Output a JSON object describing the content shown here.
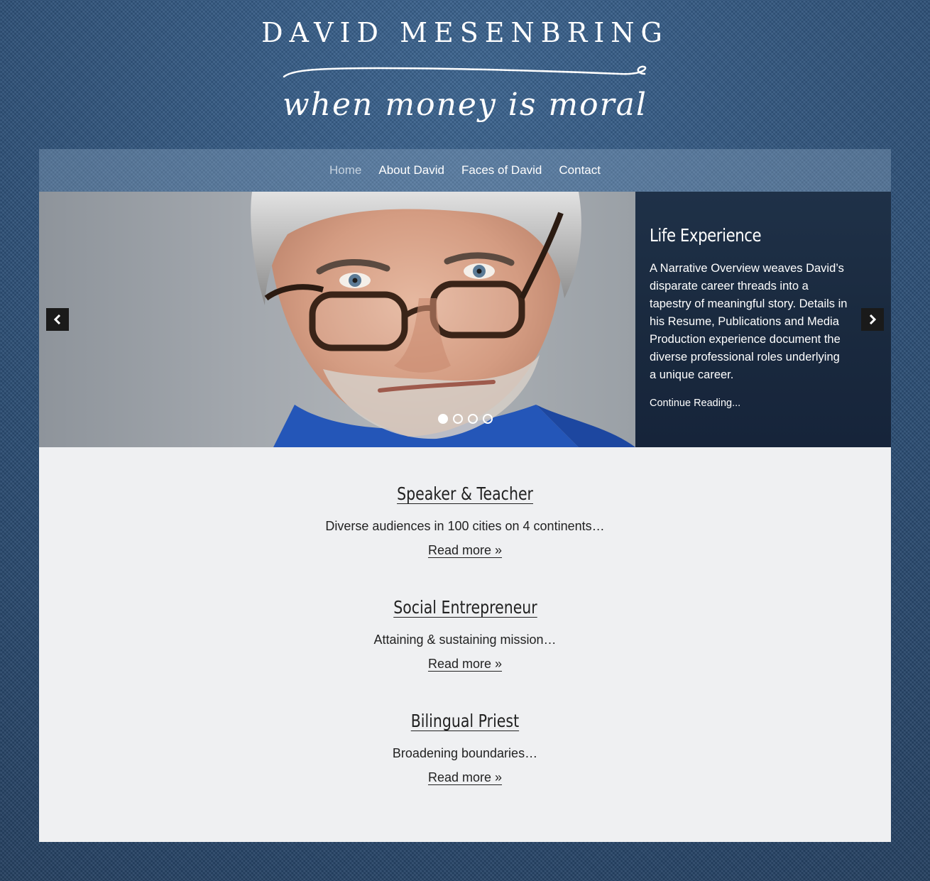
{
  "header": {
    "site_title": "DAVID MESENBRING",
    "tagline": "when money is moral"
  },
  "nav": {
    "items": [
      {
        "label": "Home",
        "active": true
      },
      {
        "label": "About David",
        "active": false
      },
      {
        "label": "Faces of David",
        "active": false
      },
      {
        "label": "Contact",
        "active": false
      }
    ]
  },
  "slider": {
    "caption_title": "Life Experience",
    "caption_text": "A Narrative Overview weaves David’s disparate career threads into a tapestry of meaningful story. Details in his Resume, Publications and Media Production experience document the diverse professional roles underlying a unique career.",
    "caption_link": "Continue Reading...",
    "slide_count": 4,
    "active_slide": 1,
    "prev_icon": "chevron-left-icon",
    "next_icon": "chevron-right-icon"
  },
  "features": [
    {
      "title": "Speaker & Teacher",
      "text": "Diverse audiences in 100 cities on 4 continents…",
      "link": "Read more »"
    },
    {
      "title": "Social Entrepreneur",
      "text": "Attaining & sustaining mission…",
      "link": "Read more »"
    },
    {
      "title": "Bilingual Priest",
      "text": "Broadening boundaries…",
      "link": "Read more »"
    }
  ],
  "colors": {
    "background": "#2b4f78",
    "content_background": "#eff0f2",
    "caption_background": "#1f3148",
    "text_dark": "#222222"
  }
}
